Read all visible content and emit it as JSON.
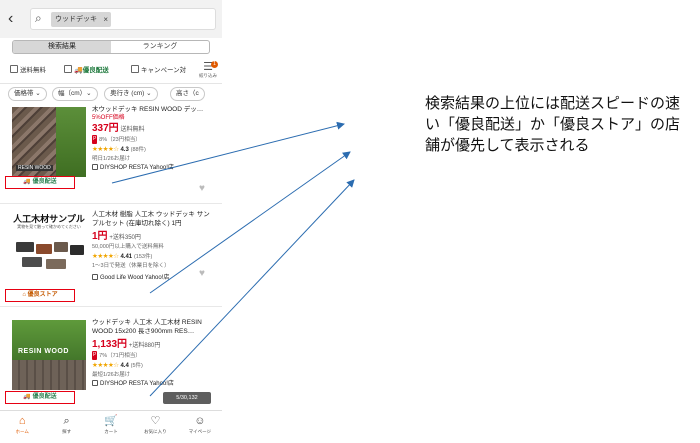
{
  "search": {
    "query": "ウッドデッキ",
    "clear": "×"
  },
  "tabs": [
    {
      "label": "検索結果",
      "active": true
    },
    {
      "label": "ランキング",
      "active": false
    }
  ],
  "filters": {
    "free_ship": "送料無料",
    "yuryo": "優良配送",
    "campaign": "キャンペーン対",
    "narrow": "絞り込み",
    "badge": "1"
  },
  "sort_pills": [
    "価格帯 ⌄",
    "幅（cm）⌄",
    "奥行き (cm) ⌄",
    "高さ（c"
  ],
  "items": [
    {
      "title": "木ウッドデッキ RESIN WOOD デッ…",
      "discount": "5%OFF価格",
      "price": "337円",
      "ship": "送料無料",
      "points": "8%（23円相当）",
      "rating": "4.3",
      "reviews": "(88件)",
      "delivery": "明日1/26お届け",
      "store": "DIYSHOP RESTA Yahoo!店",
      "tag": "優良配送",
      "image_caption": "RESIN WOOD"
    },
    {
      "title": "人工木材 樹脂 人工木 ウッドデッキ サンプルセット (在庫切れ除く) 1円",
      "price": "1円",
      "ship": "+送料350円",
      "note": "50,000円以上購入で送料無料",
      "rating": "4.41",
      "reviews": "(153件)",
      "delivery": "1〜3日で発送（休業日を除く）",
      "store": "Good Life Wood Yahoo!店",
      "tag": "優良ストア",
      "image_title": "人工木材サンプル",
      "image_sub": "実物を見て触って確かめてください"
    },
    {
      "title": "ウッドデッキ 人工木 人工木材 RESIN WOOD 15x200 長さ900mm RES…",
      "price": "1,133円",
      "ship": "+送料880円",
      "points": "7%（71円相当）",
      "rating": "4.4",
      "reviews": "(5件)",
      "delivery": "最短1/26お届け",
      "store": "DIYSHOP RESTA Yahoo!店",
      "tag": "優良配送",
      "image_caption": "RESIN WOOD"
    }
  ],
  "pager": "5/30,132",
  "bottom_nav": [
    {
      "label": "ホーム",
      "icon": "home-icon",
      "active": true
    },
    {
      "label": "探す",
      "icon": "search-icon",
      "active": false
    },
    {
      "label": "カート",
      "icon": "cart-icon",
      "active": false
    },
    {
      "label": "お気に入り",
      "icon": "heart-icon",
      "active": false
    },
    {
      "label": "マイページ",
      "icon": "user-icon",
      "active": false
    }
  ],
  "annotation": "検索結果の上位には配送スピードの速い「優良配送」か「優良ストア」の店舗が優先して表示される",
  "colors": {
    "price_red": "#d6001c",
    "tag_border": "#e60012",
    "arrow": "#2b6cb0",
    "active_nav": "#e05a00"
  }
}
